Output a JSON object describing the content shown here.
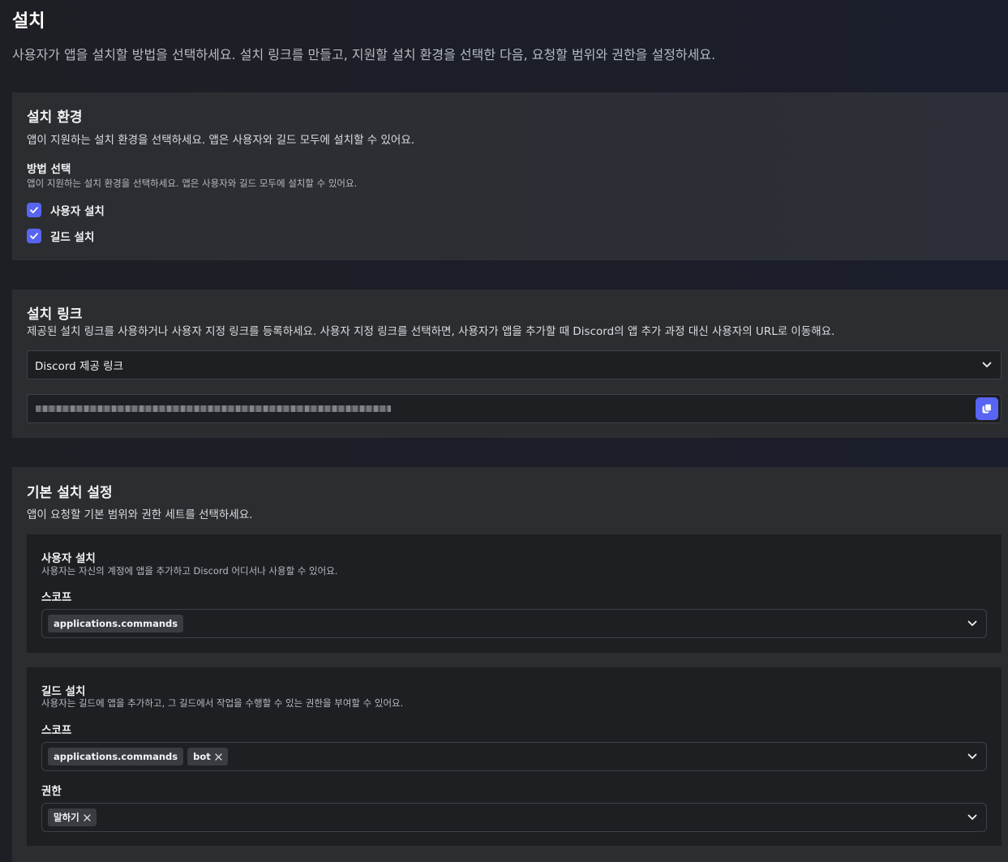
{
  "page": {
    "title": "설치",
    "subtitle": "사용자가 앱을 설치할 방법을 선택하세요. 설치 링크를 만들고, 지원할 설치 환경을 선택한 다음, 요청할 범위와 권한을 설정하세요."
  },
  "install_context": {
    "title": "설치 환경",
    "description": "앱이 지원하는 설치 환경을 선택하세요. 앱은 사용자와 길드 모두에 설치할 수 있어요.",
    "method_title": "방법 선택",
    "method_description": "앱이 지원하는 설치 환경을 선택하세요. 앱은 사용자와 길드 모두에 설치할 수 있어요.",
    "options": [
      {
        "label": "사용자 설치",
        "checked": true
      },
      {
        "label": "길드 설치",
        "checked": true
      }
    ]
  },
  "install_link": {
    "title": "설치 링크",
    "description": "제공된 설치 링크를 사용하거나 사용자 지정 링크를 등록하세요. 사용자 지정 링크를 선택하면, 사용자가 앱을 추가할 때 Discord의 앱 추가 과정 대신 사용자의 URL로 이동해요.",
    "selected": "Discord 제공 링크"
  },
  "default_settings": {
    "title": "기본 설치 설정",
    "description": "앱이 요청할 기본 범위와 권한 세트를 선택하세요.",
    "user_install": {
      "title": "사용자 설치",
      "description": "사용자는 자신의 계정에 앱을 추가하고 Discord 어디서나 사용할 수 있어요.",
      "scope_label": "스코프",
      "scopes": [
        "applications.commands"
      ]
    },
    "guild_install": {
      "title": "길드 설치",
      "description": "사용자는 길드에 앱을 추가하고, 그 길드에서 작업을 수행할 수 있는 권한을 부여할 수 있어요.",
      "scope_label": "스코프",
      "scopes": [
        "applications.commands",
        "bot"
      ],
      "permission_label": "권한",
      "permissions": [
        "말하기"
      ]
    }
  },
  "colors": {
    "accent": "#5865f2",
    "card": "#2b2d31",
    "input": "#1e1f22"
  },
  "icons": [
    "check-icon",
    "chevron-down-icon",
    "copy-icon",
    "close-icon"
  ]
}
